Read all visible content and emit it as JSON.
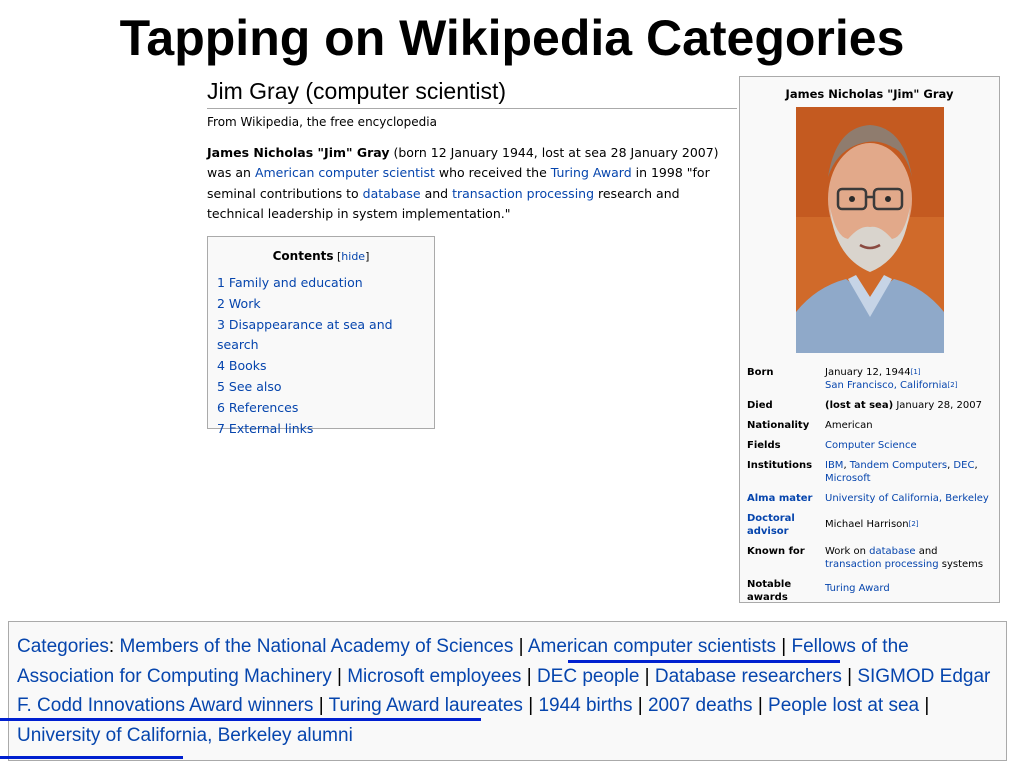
{
  "slide": {
    "title": "Tapping on Wikipedia Categories"
  },
  "article": {
    "title": "Jim Gray (computer scientist)",
    "tagline": "From Wikipedia, the free encyclopedia",
    "lead": {
      "name": "James Nicholas \"Jim\" Gray",
      "t1": " (born 12 January 1944, lost at sea 28 January 2007) was an ",
      "l1": "American computer scientist",
      "t2": " who received the ",
      "l2": "Turing Award",
      "t3": " in 1998 \"for seminal contributions to ",
      "l3": "database",
      "t4": " and ",
      "l4": "transaction processing",
      "t5": " research and technical leadership in system implementation.\""
    }
  },
  "toc": {
    "title": "Contents",
    "hide_open": " [",
    "hide": "hide",
    "hide_close": "]",
    "items": [
      "1 Family and education",
      "2 Work",
      "3 Disappearance at sea and search",
      "4 Books",
      "5 See also",
      "6 References",
      "7 External links"
    ]
  },
  "infobox": {
    "title": "James Nicholas \"Jim\" Gray",
    "born_label": "Born",
    "born_date": "January 12, 1944",
    "born_ref1": "[1]",
    "born_place": "San Francisco, California",
    "born_ref2": "[2]",
    "died_label": "Died",
    "died_bold": "(lost at sea)",
    "died_date": " January 28, 2007",
    "nationality_label": "Nationality",
    "nationality": "American",
    "fields_label": "Fields",
    "fields": "Computer Science",
    "institutions_label": "Institutions",
    "inst1": "IBM",
    "sep": ", ",
    "inst2": "Tandem Computers",
    "inst3": "DEC",
    "inst4": "Microsoft",
    "alma_label": "Alma mater",
    "alma": "University of California, Berkeley",
    "advisor_label": "Doctoral advisor",
    "advisor": "Michael Harrison",
    "advisor_ref": "[2]",
    "known_label": "Known for",
    "known_pre": "Work on ",
    "known_l1": "database",
    "known_and": " and ",
    "known_l2": "transaction processing",
    "known_post": " systems",
    "awards_label": "Notable awards",
    "awards": "Turing Award"
  },
  "categories": {
    "label": "Categories",
    "colon": ": ",
    "sep": " | ",
    "items": [
      "Members of the National Academy of Sciences",
      "American computer scientists",
      "Fellows of the Association for Computing Machinery",
      "Microsoft employees",
      "DEC people",
      "Database researchers",
      "SIGMOD Edgar F. Codd Innovations Award winners",
      "Turing Award laureates",
      "1944 births",
      "2007 deaths",
      "People lost at sea",
      "University of California, Berkeley alumni"
    ],
    "underlined": [
      "American computer scientists",
      "SIGMOD Edgar F. Codd Innovations Award winners",
      "People lost at sea"
    ]
  },
  "colors": {
    "link": "#0645ad",
    "underline": "#0020d0",
    "border": "#aaaaaa",
    "box_bg": "#f9f9f9"
  },
  "icons": {
    "portrait": "person-photo"
  }
}
